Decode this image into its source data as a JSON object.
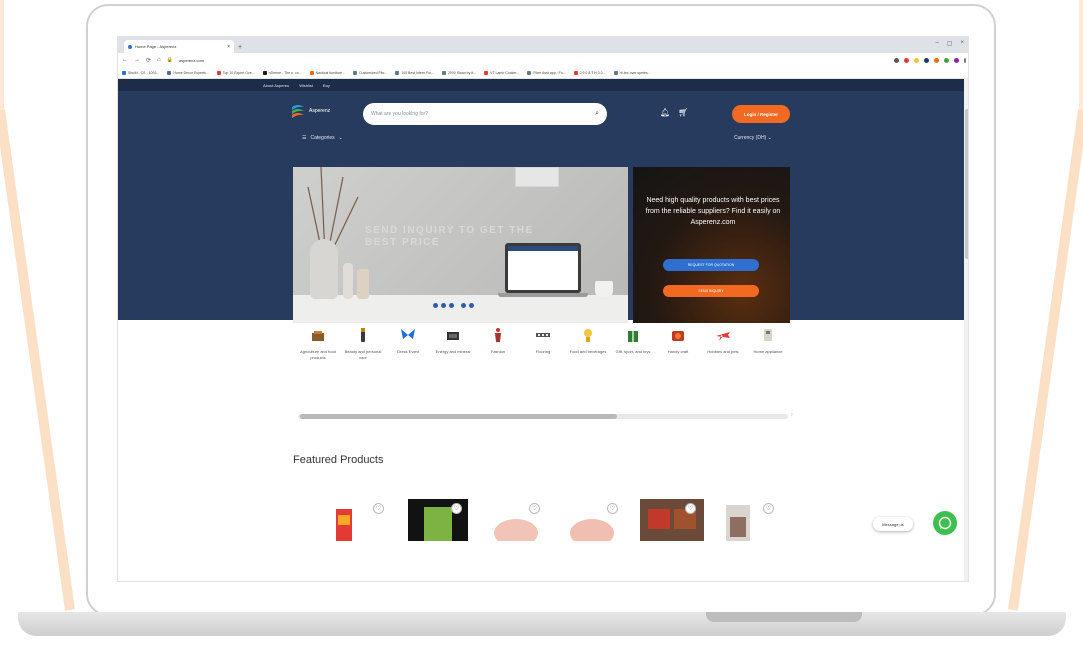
{
  "browser": {
    "tab_title": "Home Page - Asperenz",
    "url": "asperenz.com",
    "bookmarks": [
      "Shuiki - CS - 1092...",
      "Home Decor Experts...",
      "Top 10 Expert Ove...",
      "nDreme - The n. co...",
      "Nautical furniture...",
      "Customized Fibr...",
      "100 Best Intern Fur...",
      "2000 Sloan by-it...",
      "VT Lamb Cooker...",
      "Fibre Asst app / Fu...",
      "2 9 0 8 T H 0 0...",
      "Hi-tec over spetes..."
    ]
  },
  "site": {
    "top_links": [
      "About Aspereu",
      "Wishlist",
      "Buy"
    ],
    "brand": "Asperenz",
    "search_placeholder": "What are you looking for?",
    "login_label": "Login / Register",
    "categories_label": "Categories",
    "currency_label": "Currency (DH)",
    "banner_title": "SEND INQUIRY TO GET THE BEST PRICE",
    "promo_text": "Need high quality products with best prices from the reliable suppliers? Find it easily on Asperenz.com",
    "promo_button_primary": "REQUEST FOR QUOTATION",
    "promo_button_secondary": "SEND INQUIRY",
    "categories": [
      {
        "label": "Agriculture and food products",
        "icon": "agriculture-icon"
      },
      {
        "label": "Beauty and personal care",
        "icon": "beauty-icon"
      },
      {
        "label": "Dress Event",
        "icon": "butterfly-icon"
      },
      {
        "label": "Energy and mineral",
        "icon": "energy-icon"
      },
      {
        "label": "Fashion",
        "icon": "fashion-icon"
      },
      {
        "label": "Flooring",
        "icon": "flooring-icon"
      },
      {
        "label": "Food and beverages",
        "icon": "food-icon"
      },
      {
        "label": "Gift, sport, and toys",
        "icon": "gift-icon"
      },
      {
        "label": "Handy craft",
        "icon": "handycraft-icon"
      },
      {
        "label": "Hobbies and pets",
        "icon": "hobbies-icon"
      },
      {
        "label": "Home appliance",
        "icon": "appliance-icon"
      }
    ],
    "featured_title": "Featured Products",
    "message_label": "Message us"
  },
  "colors": {
    "header_bg": "#263b5e",
    "accent_orange": "#f26a21",
    "accent_blue": "#2e6fd0"
  }
}
